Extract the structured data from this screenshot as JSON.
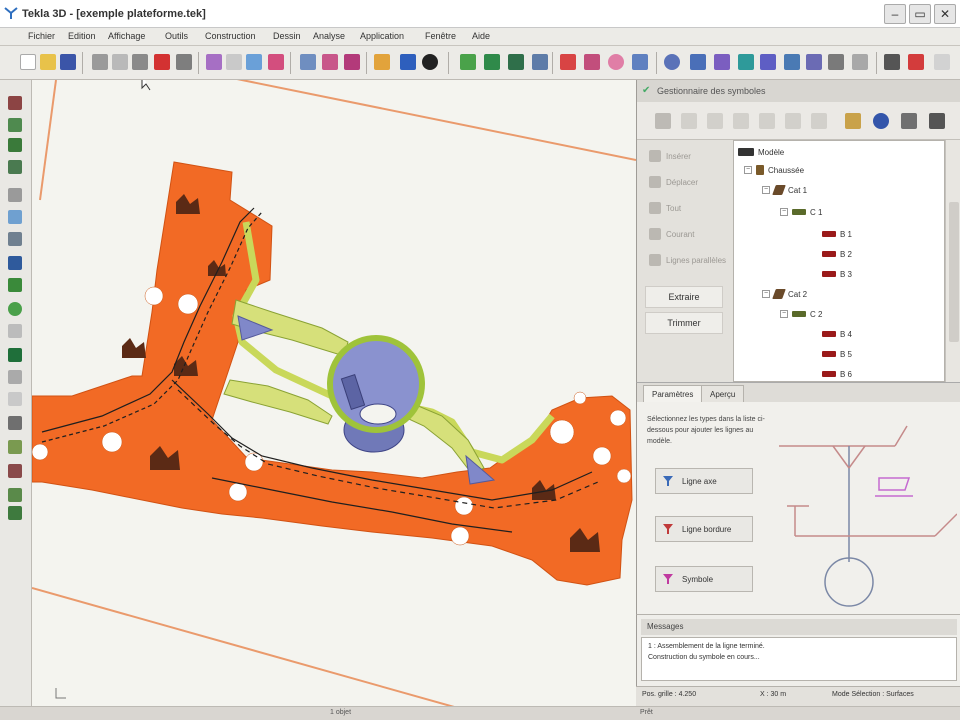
{
  "window": {
    "title": "Tekla 3D - [exemple plateforme.tek]",
    "controls": [
      "–",
      "▭",
      "✕"
    ]
  },
  "menu": {
    "items": [
      "Fichier",
      "Edition",
      "Affichage",
      "Outils",
      "Construction",
      "Dessin",
      "Analyse",
      "Application",
      "Fenêtre",
      "Aide"
    ]
  },
  "tree_panel": {
    "title": "Gestionnaire des symboles",
    "side_actions": [
      "Insérer",
      "Déplacer",
      "Tout",
      "Courant",
      "Lignes parallèles"
    ],
    "side_buttons": [
      "Extraire",
      "Trimmer"
    ],
    "tree_nodes": [
      {
        "label": "Modèle",
        "level": 0,
        "icon": "model-icon"
      },
      {
        "label": "Chaussée",
        "level": 1,
        "icon": "group-icon"
      },
      {
        "label": "Cat 1",
        "level": 2,
        "icon": "category-icon"
      },
      {
        "label": "C 1",
        "level": 3,
        "icon": "line-green-icon"
      },
      {
        "label": "B 1",
        "level": 4,
        "icon": "line-red-icon"
      },
      {
        "label": "B 2",
        "level": 4,
        "icon": "line-red-icon"
      },
      {
        "label": "B 3",
        "level": 4,
        "icon": "line-red-icon"
      },
      {
        "label": "Cat 2",
        "level": 2,
        "icon": "category-icon"
      },
      {
        "label": "C 2",
        "level": 3,
        "icon": "line-green-icon"
      },
      {
        "label": "B 4",
        "level": 4,
        "icon": "line-red-icon"
      },
      {
        "label": "B 5",
        "level": 4,
        "icon": "line-red-icon"
      },
      {
        "label": "B 6",
        "level": 4,
        "icon": "line-red-icon"
      }
    ]
  },
  "tabs": [
    "Paramètres",
    "Aperçu"
  ],
  "params": {
    "help_text": "Sélectionnez les types dans la liste ci-dessous pour ajouter les lignes au modèle.",
    "buttons": [
      "Ligne axe",
      "Ligne bordure",
      "Symbole"
    ]
  },
  "messages": {
    "title": "Messages",
    "lines": [
      "1 : Assemblement de la ligne terminé.",
      "Construction du symbole en cours..."
    ]
  },
  "status": {
    "cells": [
      "Pos. grille : 4.250",
      "X : 30 m",
      "Mode Sélection : Surfaces"
    ]
  },
  "bottom": {
    "center": "1 objet",
    "right": "Prêt"
  },
  "colors": {
    "platform": "#f26a25",
    "platform_edge": "#c9d85a",
    "structure": "#8088c9",
    "line": "#1f1f1f",
    "canvas_bg": "#f4f4ef",
    "reference_line": "#ea9a6c"
  }
}
